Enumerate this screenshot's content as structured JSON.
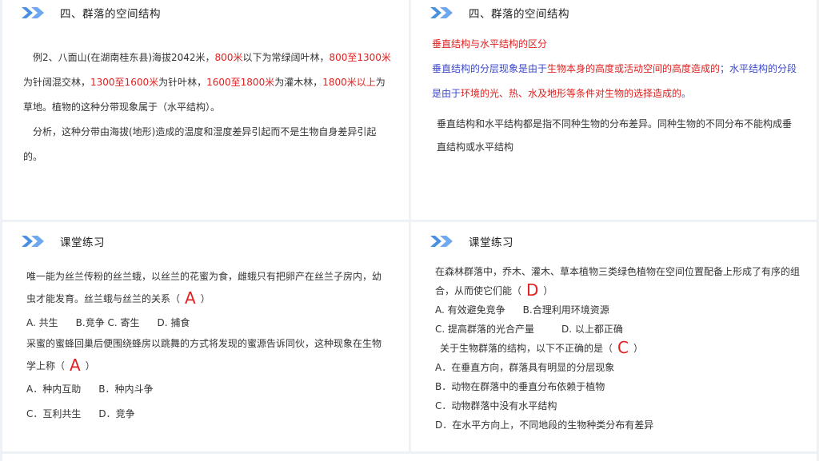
{
  "colors": {
    "red_highlight": "#e02020",
    "blue_text": "#3b47c8",
    "chevron": "#4a90e2"
  },
  "panel1": {
    "title": "四、群落的空间结构",
    "example": [
      {
        "t": "例2、八面山(在湖南桂东县)海拔2042米，",
        "c": ""
      },
      {
        "t": "800米",
        "c": "red"
      },
      {
        "t": "以下为常绿阔叶林，",
        "c": ""
      },
      {
        "t": "800至1300米",
        "c": "red"
      },
      {
        "t": "为针阔混交林，",
        "c": ""
      },
      {
        "t": "1300至1600米",
        "c": "red"
      },
      {
        "t": "为针叶林，",
        "c": ""
      },
      {
        "t": "1600至1800米",
        "c": "red"
      },
      {
        "t": "为灌木林，",
        "c": ""
      },
      {
        "t": "1800米以上",
        "c": "red"
      },
      {
        "t": "为草地。植物的这种分带现象属于（水平结构）。",
        "c": ""
      }
    ],
    "analysis": "分析，这种分带由海拔(地形)造成的温度和湿度差异引起而不是生物自身差异引起的。"
  },
  "panel2": {
    "title": "四、群落的空间结构",
    "heading": "垂直结构与水平结构的区分",
    "para": [
      {
        "t": "垂直结构的分层现象是由于",
        "c": "blue"
      },
      {
        "t": "生物本身的高度或活动空间的高度造成的",
        "c": "red"
      },
      {
        "t": "；水平结构的分段是由于",
        "c": "blue"
      },
      {
        "t": "环境的光、热、水及地形等条件对生物的选择造成的",
        "c": "red"
      },
      {
        "t": "。",
        "c": "blue"
      }
    ],
    "note": "垂直结构和水平结构都是指不同种生物的分布差异。同种生物的不同分布不能构成垂直结构或水平结构"
  },
  "panel3": {
    "title": "课堂练习",
    "q1": {
      "stem": "唯一能为丝兰传粉的丝兰蛾，以丝兰的花蜜为食，雌蛾只有把卵产在丝兰子房内，幼虫才能发育。丝兰蛾与丝兰的关系（",
      "answer": "A",
      "close": "）",
      "opt_a": "A. 共生",
      "opt_b": "B.竞争",
      "opt_c": "C. 寄生",
      "opt_d": "D. 捕食"
    },
    "q2": {
      "stem": "采蜜的蜜蜂回巢后便围绕蜂房以跳舞的方式将发现的蜜源告诉同伙，这种现象在生物学上称（",
      "answer": "A",
      "close": "）",
      "opt_a": "A．种内互助",
      "opt_b": "B．种内斗争",
      "opt_c": "C．互利共生",
      "opt_d": "D．竞争"
    }
  },
  "panel4": {
    "title": "课堂练习",
    "q1": {
      "stem": "在森林群落中，乔木、灌木、草本植物三类绿色植物在空间位置配备上形成了有序的组合，从而使它们能（",
      "answer": "D",
      "close": "）",
      "opt_a": "A. 有效避免竞争",
      "opt_b": "B.合理利用环境资源",
      "opt_c": "C. 提高群落的光合产量",
      "opt_d": "D. 以上都正确"
    },
    "q2": {
      "stem": "关于生物群落的结构，以下不正确的是（",
      "answer": "C",
      "close": "）",
      "opt_a": "A．在垂直方向，群落具有明显的分层现象",
      "opt_b": "B．动物在群落中的垂直分布依赖于植物",
      "opt_c": "C．动物群落中没有水平结构",
      "opt_d": "D．在水平方向上，不同地段的生物种类分布有差异"
    }
  }
}
